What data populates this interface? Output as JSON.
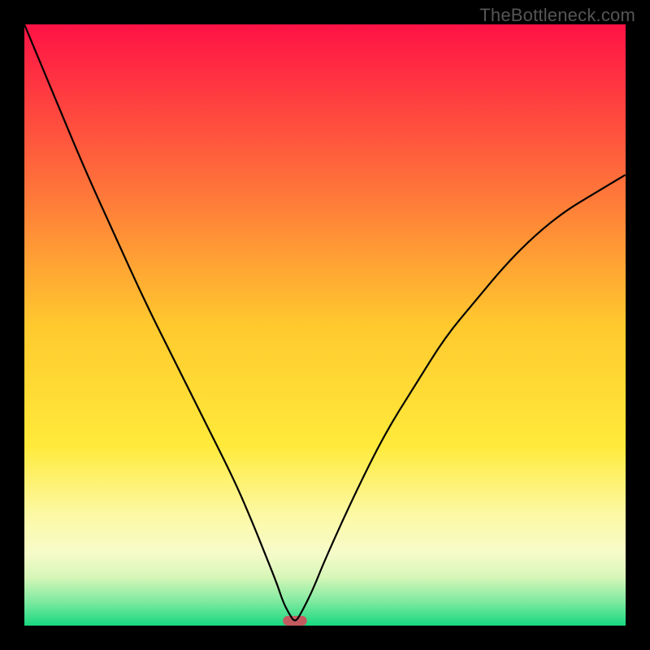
{
  "watermark": "TheBottleneck.com",
  "chart_data": {
    "type": "line",
    "title": "",
    "xlabel": "",
    "ylabel": "",
    "xlim": [
      0,
      100
    ],
    "ylim": [
      0,
      100
    ],
    "grid": false,
    "legend": false,
    "series": [
      {
        "name": "curve",
        "x": [
          0,
          5,
          10,
          15,
          20,
          25,
          30,
          35,
          38,
          40,
          42,
          43,
          44,
          45,
          46,
          48,
          50,
          55,
          60,
          65,
          70,
          75,
          80,
          85,
          90,
          95,
          100
        ],
        "values": [
          100,
          88,
          76,
          65,
          54,
          44,
          34,
          24,
          17,
          12,
          7,
          4,
          2,
          0.5,
          2,
          6,
          11,
          22,
          32,
          40,
          48,
          54,
          60,
          65,
          69,
          72,
          75
        ]
      }
    ],
    "marker": {
      "x": 45,
      "width": 4,
      "color": "#c25b60"
    },
    "background_gradient": {
      "stops": [
        {
          "offset": 0.0,
          "color": "#ff1245"
        },
        {
          "offset": 0.25,
          "color": "#ff6b3b"
        },
        {
          "offset": 0.5,
          "color": "#ffc92e"
        },
        {
          "offset": 0.7,
          "color": "#ffea3a"
        },
        {
          "offset": 0.82,
          "color": "#fcf9a8"
        },
        {
          "offset": 0.88,
          "color": "#f6fbc9"
        },
        {
          "offset": 0.92,
          "color": "#d6f6b8"
        },
        {
          "offset": 0.96,
          "color": "#7eeaa0"
        },
        {
          "offset": 1.0,
          "color": "#18d880"
        }
      ]
    }
  }
}
